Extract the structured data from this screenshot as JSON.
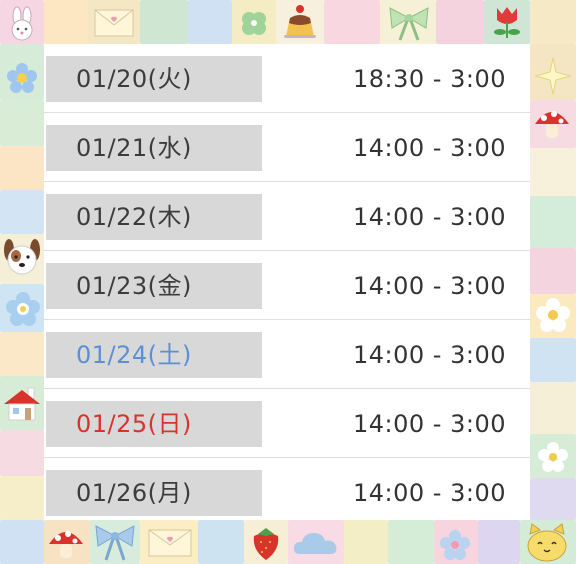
{
  "colors": {
    "weekday": "#3c3c3c",
    "saturday": "#5b8fd6",
    "sunday": "#d9342b",
    "date_box": "#d8d8d8",
    "time": "#333333"
  },
  "schedule": [
    {
      "date": "01/20(火)",
      "time": "18:30 - 3:00",
      "kind": "weekday"
    },
    {
      "date": "01/21(水)",
      "time": "14:00 - 3:00",
      "kind": "weekday"
    },
    {
      "date": "01/22(木)",
      "time": "14:00 - 3:00",
      "kind": "weekday"
    },
    {
      "date": "01/23(金)",
      "time": "14:00 - 3:00",
      "kind": "weekday"
    },
    {
      "date": "01/24(土)",
      "time": "14:00 - 3:00",
      "kind": "saturday"
    },
    {
      "date": "01/25(日)",
      "time": "14:00 - 3:00",
      "kind": "sunday"
    },
    {
      "date": "01/26(月)",
      "time": "14:00 - 3:00",
      "kind": "weekday"
    }
  ],
  "decorations": [
    "rabbit-icon",
    "envelope-icon",
    "clover-icon",
    "pudding-icon",
    "ribbon-icon",
    "tulip-icon",
    "flower-icon",
    "sparkle-icon",
    "mushroom-icon",
    "puppy-icon",
    "house-icon",
    "strawberry-icon",
    "cloud-icon",
    "cat-icon"
  ]
}
